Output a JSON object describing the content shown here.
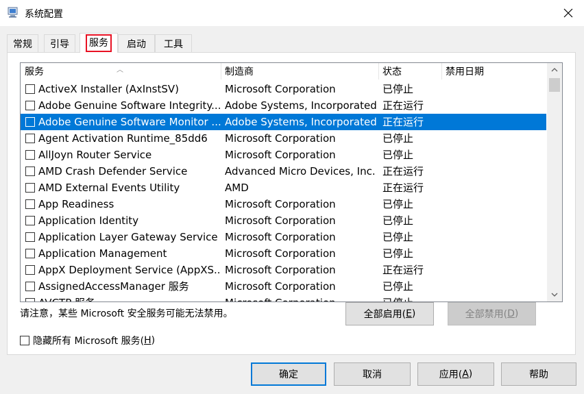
{
  "window": {
    "title": "系统配置",
    "icon": "msconfig-icon"
  },
  "tabs": [
    {
      "label": "常规"
    },
    {
      "label": "引导"
    },
    {
      "label": "服务",
      "selected": true
    },
    {
      "label": "启动"
    },
    {
      "label": "工具"
    }
  ],
  "columns": {
    "name": "服务",
    "manufacturer": "制造商",
    "status": "状态",
    "disabled_date": "禁用日期"
  },
  "services": [
    {
      "name": "ActiveX Installer (AxInstSV)",
      "manufacturer": "Microsoft Corporation",
      "status": "已停止",
      "checked": false
    },
    {
      "name": "Adobe Genuine Software Integrity...",
      "manufacturer": "Adobe Systems, Incorporated",
      "status": "正在运行",
      "checked": false
    },
    {
      "name": "Adobe Genuine Software Monitor ...",
      "manufacturer": "Adobe Systems, Incorporated",
      "status": "正在运行",
      "checked": false,
      "selected": true
    },
    {
      "name": "Agent Activation Runtime_85dd6",
      "manufacturer": "Microsoft Corporation",
      "status": "已停止",
      "checked": false
    },
    {
      "name": "AllJoyn Router Service",
      "manufacturer": "Microsoft Corporation",
      "status": "已停止",
      "checked": false
    },
    {
      "name": "AMD Crash Defender Service",
      "manufacturer": "Advanced Micro Devices, Inc.",
      "status": "正在运行",
      "checked": false
    },
    {
      "name": "AMD External Events Utility",
      "manufacturer": "AMD",
      "status": "正在运行",
      "checked": false
    },
    {
      "name": "App Readiness",
      "manufacturer": "Microsoft Corporation",
      "status": "已停止",
      "checked": false
    },
    {
      "name": "Application Identity",
      "manufacturer": "Microsoft Corporation",
      "status": "已停止",
      "checked": false
    },
    {
      "name": "Application Layer Gateway Service",
      "manufacturer": "Microsoft Corporation",
      "status": "已停止",
      "checked": false
    },
    {
      "name": "Application Management",
      "manufacturer": "Microsoft Corporation",
      "status": "已停止",
      "checked": false
    },
    {
      "name": "AppX Deployment Service (AppXS...",
      "manufacturer": "Microsoft Corporation",
      "status": "正在运行",
      "checked": false
    },
    {
      "name": "AssignedAccessManager 服务",
      "manufacturer": "Microsoft Corporation",
      "status": "已停止",
      "checked": false
    },
    {
      "name": "AVCTP 服务",
      "manufacturer": "Microsoft Corporation",
      "status": "已停止",
      "checked": false
    }
  ],
  "notice": "请注意，某些 Microsoft 安全服务可能无法禁用。",
  "enable_all": {
    "label": "全部启用(",
    "accel": "E",
    "suffix": ")"
  },
  "disable_all": {
    "label": "全部禁用(",
    "accel": "D",
    "suffix": ")"
  },
  "hide_ms": {
    "label": "隐藏所有 Microsoft 服务(",
    "accel": "H",
    "suffix": ")",
    "checked": false
  },
  "footer": {
    "ok": "确定",
    "cancel": "取消",
    "apply": {
      "label": "应用(",
      "accel": "A",
      "suffix": ")"
    },
    "help": "帮助"
  },
  "colors": {
    "selection": "#0078d7",
    "tab_highlight": "#e81123"
  }
}
